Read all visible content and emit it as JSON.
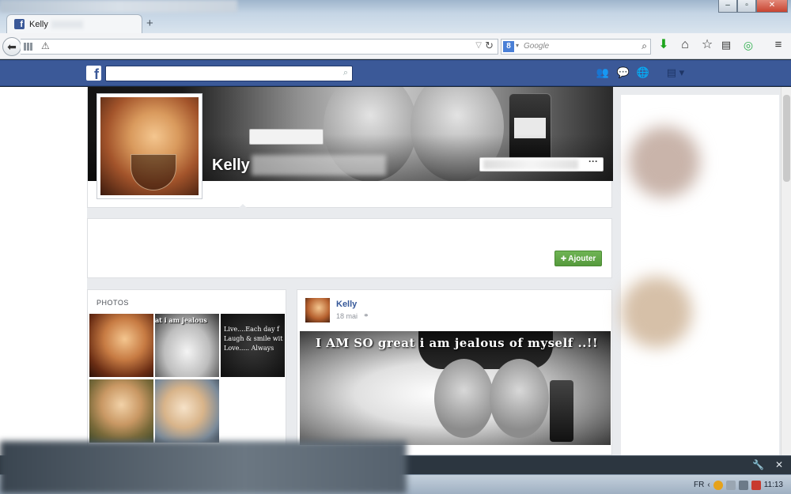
{
  "browser": {
    "tab_title": "Kelly",
    "new_tab_label": "+",
    "url_value": "",
    "search_engine_label": "Google",
    "window_buttons": {
      "minimize": "–",
      "maximize": "▫",
      "close": "✕"
    }
  },
  "facebook": {
    "search_placeholder": "",
    "profile": {
      "name": "Kelly",
      "add_friend_label": "Ajouter",
      "cover_more_label": "···"
    },
    "photos": {
      "header": "PHOTOS",
      "thumb_texts": [
        "",
        "at i am jealous",
        "Live....Each day f Laugh & smile wit Love..... Always",
        "",
        ""
      ]
    },
    "post": {
      "author": "Kelly",
      "date": "18 mai",
      "caption": "I AM SO great i am jealous of myself ..!!"
    }
  },
  "taskbar": {
    "language": "FR",
    "time": "11:13"
  },
  "colors": {
    "facebook_blue": "#3b5998",
    "add_friend_green": "#5ea844"
  },
  "icons": {
    "download": "download-icon",
    "home": "home-icon",
    "bookmark": "star-icon",
    "clipboard": "clipboard-icon",
    "addon": "addon-icon",
    "menu": "hamburger-menu-icon"
  }
}
